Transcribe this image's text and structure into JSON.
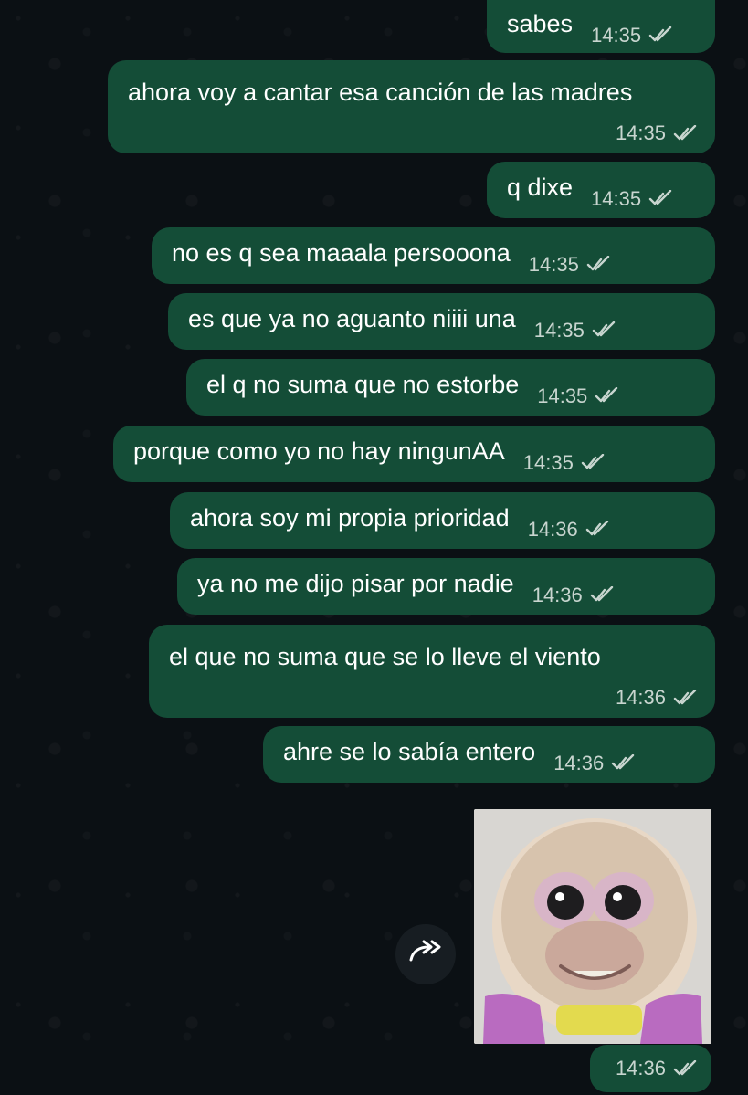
{
  "messages": [
    {
      "text": "sabes",
      "time": "14:35"
    },
    {
      "text": "ahora voy a cantar esa canción de las madres",
      "time": "14:35"
    },
    {
      "text": "q dixe",
      "time": "14:35"
    },
    {
      "text": "no es q sea maaala persooona",
      "time": "14:35"
    },
    {
      "text": "es que ya no aguanto niiii una",
      "time": "14:35"
    },
    {
      "text": "el q no suma que no estorbe",
      "time": "14:35"
    },
    {
      "text": "porque como yo no hay ningunAA",
      "time": "14:35"
    },
    {
      "text": "ahora soy mi propia prioridad",
      "time": "14:36"
    },
    {
      "text": "ya no me dijo pisar por nadie",
      "time": "14:36"
    },
    {
      "text": "el que no suma que se lo lleve el viento",
      "time": "14:36"
    },
    {
      "text": "ahre se lo sabía entero",
      "time": "14:36"
    }
  ],
  "sticker": {
    "time": "14:36",
    "forward_icon": "forward-arrow-icon"
  },
  "status": {
    "read_icon": "double-check-icon",
    "accent": "#144d37",
    "background": "#0b1014"
  }
}
